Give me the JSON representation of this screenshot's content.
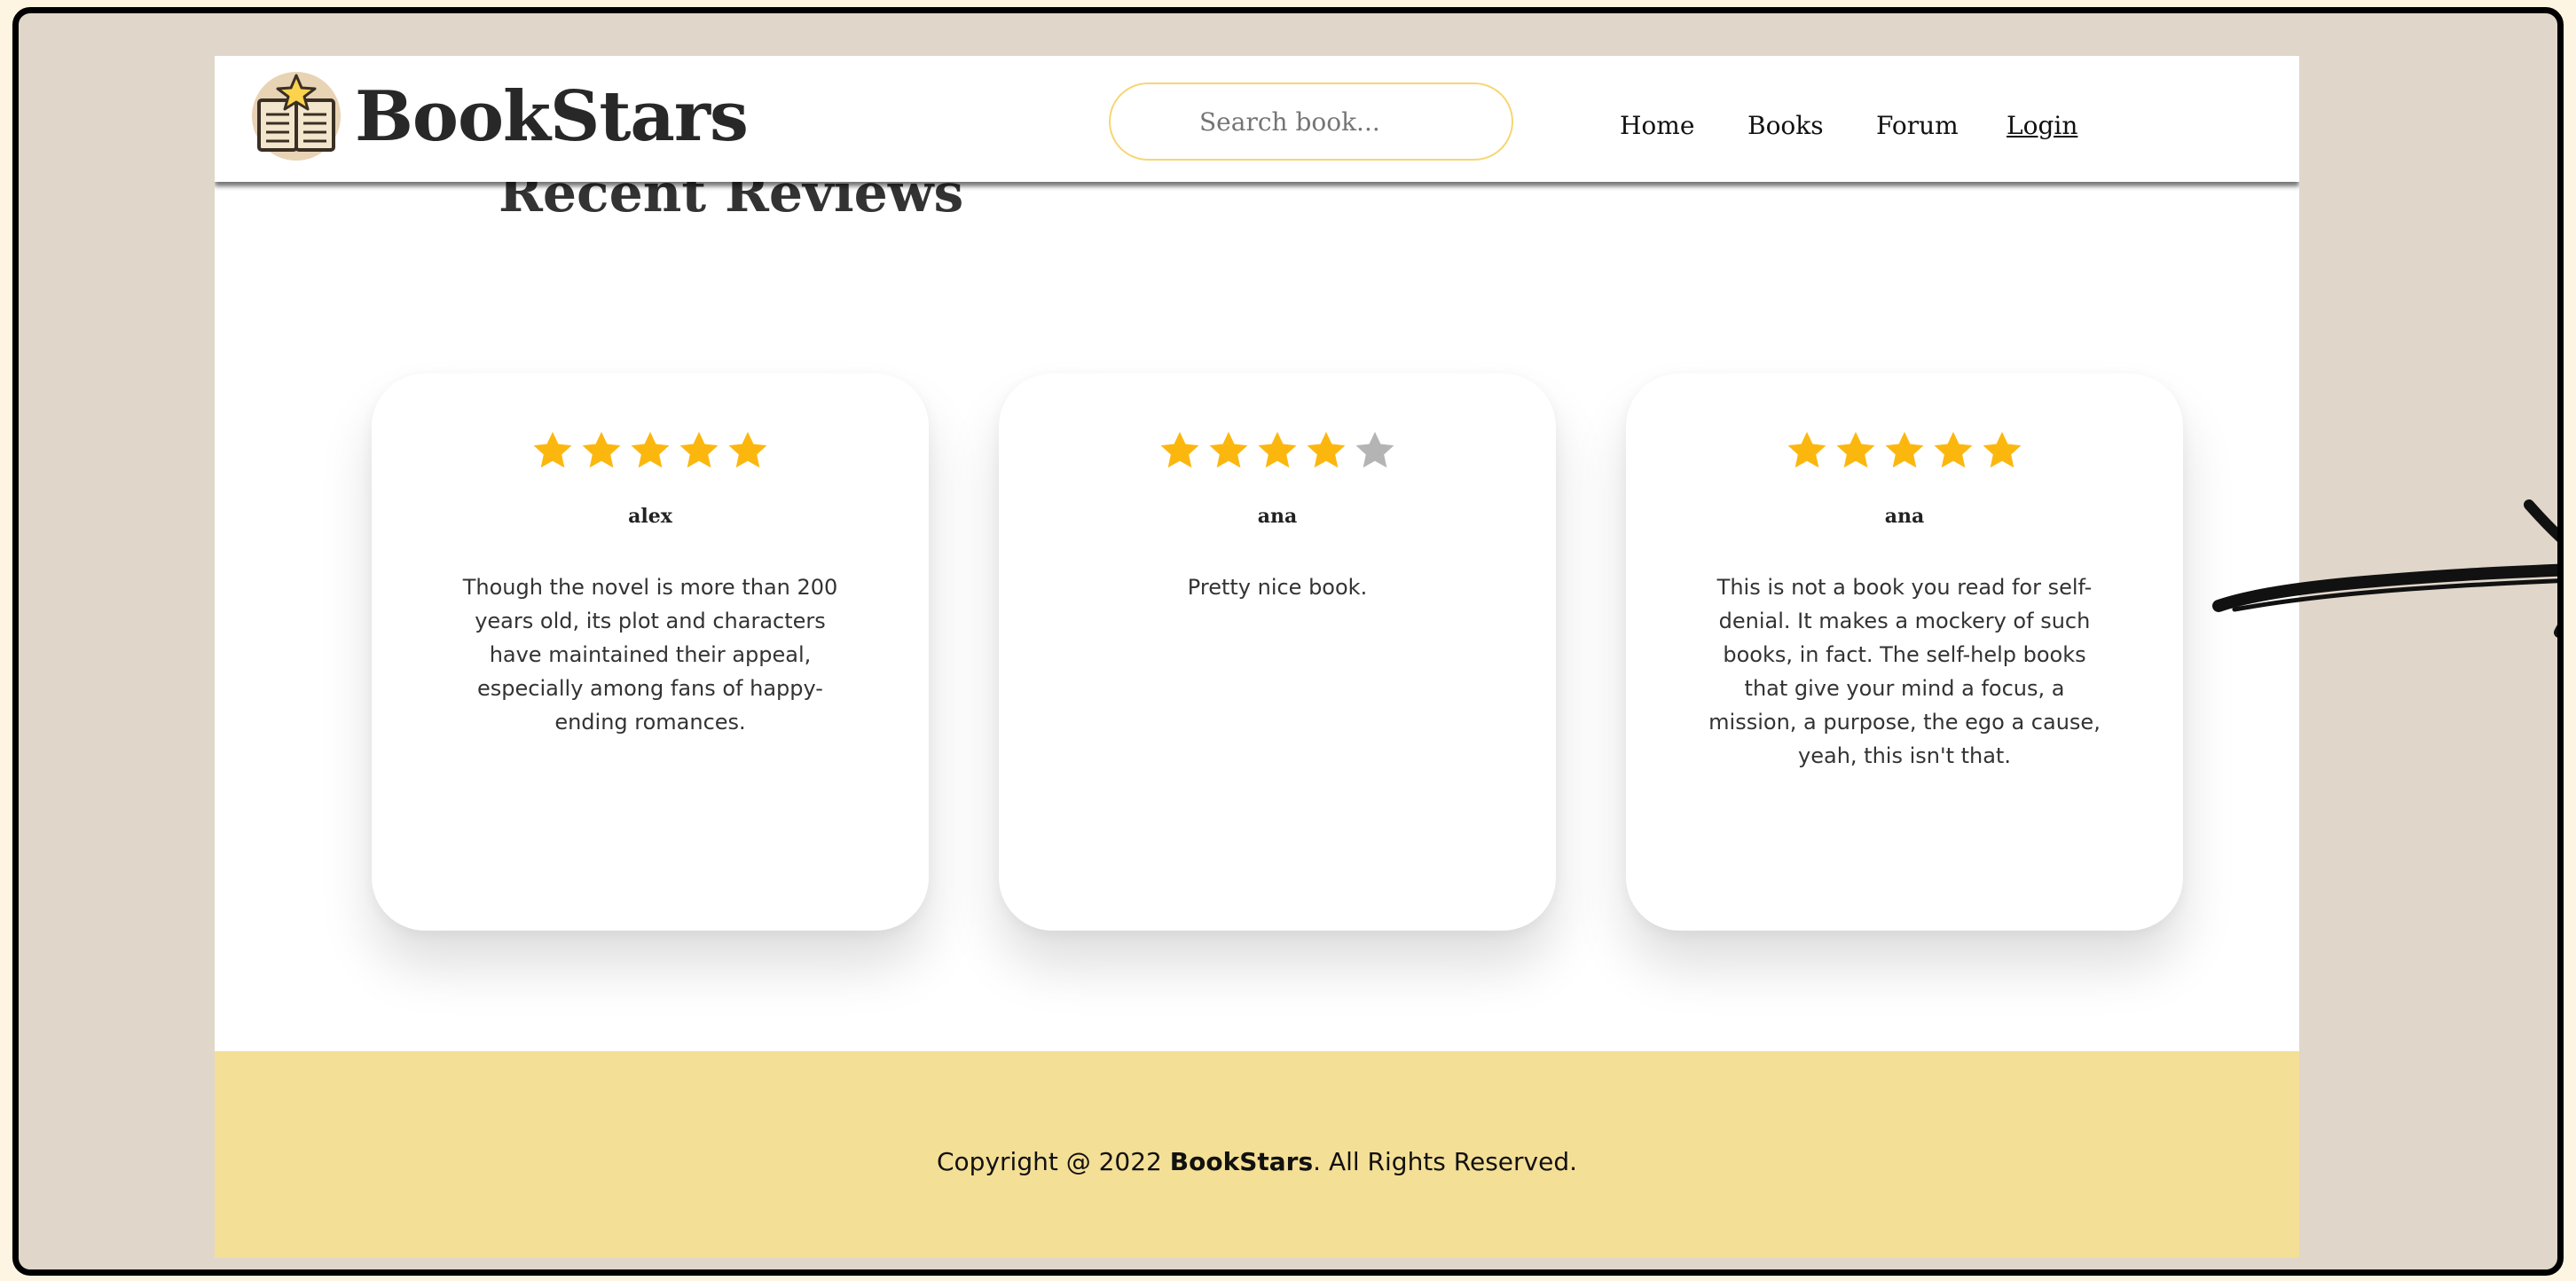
{
  "header": {
    "logo_text": "BookStars",
    "logo_icon": "open-book-star-icon",
    "search_placeholder": "Search book...",
    "nav": {
      "home": "Home",
      "books": "Books",
      "forum": "Forum",
      "login": "Login"
    }
  },
  "section": {
    "title": "Recent Reviews"
  },
  "reviews": [
    {
      "rating": 5,
      "max_rating": 5,
      "author": "alex",
      "text": "Though the novel is more than 200 years old, its plot and characters have maintained their appeal, especially among fans of happy-ending romances."
    },
    {
      "rating": 4,
      "max_rating": 5,
      "author": "ana",
      "text": "Pretty nice book."
    },
    {
      "rating": 5,
      "max_rating": 5,
      "author": "ana",
      "text": "This is not a book you read for self-denial. It makes a mockery of such books, in fact. The self-help books that give your mind a focus, a mission, a purpose, the ego a cause, yeah, this isn't that."
    }
  ],
  "footer": {
    "prefix": "Copyright @ 2022 ",
    "brand": "BookStars",
    "suffix": ". All Rights Reserved."
  },
  "colors": {
    "star_filled": "#fcb70f",
    "star_empty": "#b4b4b4",
    "footer_bg": "#f4df96",
    "search_border": "#f6d673",
    "backdrop": "#e0d6ca"
  },
  "decor": {
    "arrow_icon": "hand-drawn-arrow-icon"
  }
}
